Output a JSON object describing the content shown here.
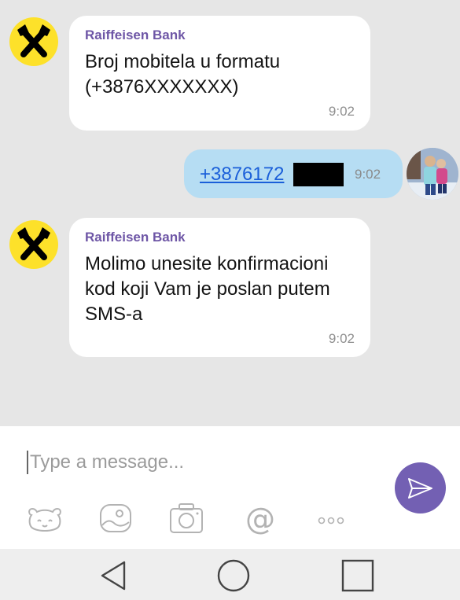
{
  "messages": [
    {
      "sender": "Raiffeisen Bank",
      "lines": [
        "Broj mobitela u formatu",
        "(+3876XXXXXXX)"
      ],
      "time": "9:02"
    },
    {
      "phone": "+3876172",
      "time": "9:02"
    },
    {
      "sender": "Raiffeisen Bank",
      "lines": [
        "Molimo unesite konfirmacioni",
        "kod koji Vam je poslan putem",
        "SMS-a"
      ],
      "time": "9:02"
    }
  ],
  "composer": {
    "placeholder": "Type a message..."
  },
  "icons": {
    "toolbar": [
      "sticker-icon",
      "gallery-icon",
      "camera-icon",
      "mention-icon",
      "more-icon"
    ],
    "navbar": [
      "back-icon",
      "home-icon",
      "recents-icon"
    ]
  },
  "colors": {
    "brand": "#7360b3",
    "sender": "#6e56a6",
    "outgoing_bubble": "#b6ddf3",
    "bank_logo": "#fde12a"
  }
}
